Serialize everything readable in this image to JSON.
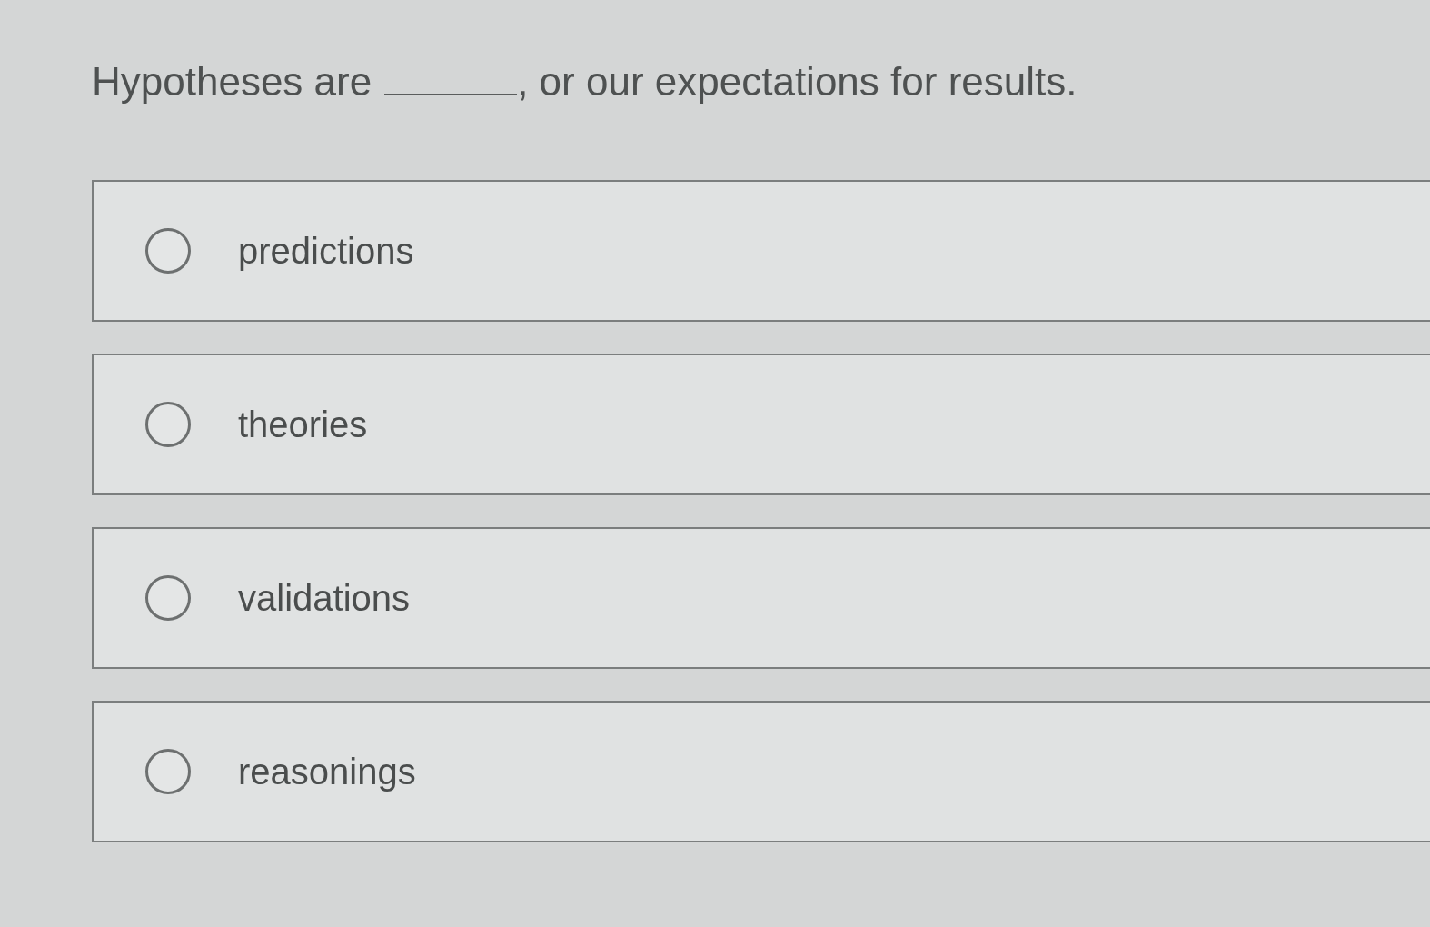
{
  "question": {
    "text_before": "Hypotheses are",
    "text_after": ", or our expectations for results."
  },
  "options": [
    {
      "label": "predictions",
      "selected": false
    },
    {
      "label": "theories",
      "selected": false
    },
    {
      "label": "validations",
      "selected": false
    },
    {
      "label": "reasonings",
      "selected": false
    }
  ]
}
